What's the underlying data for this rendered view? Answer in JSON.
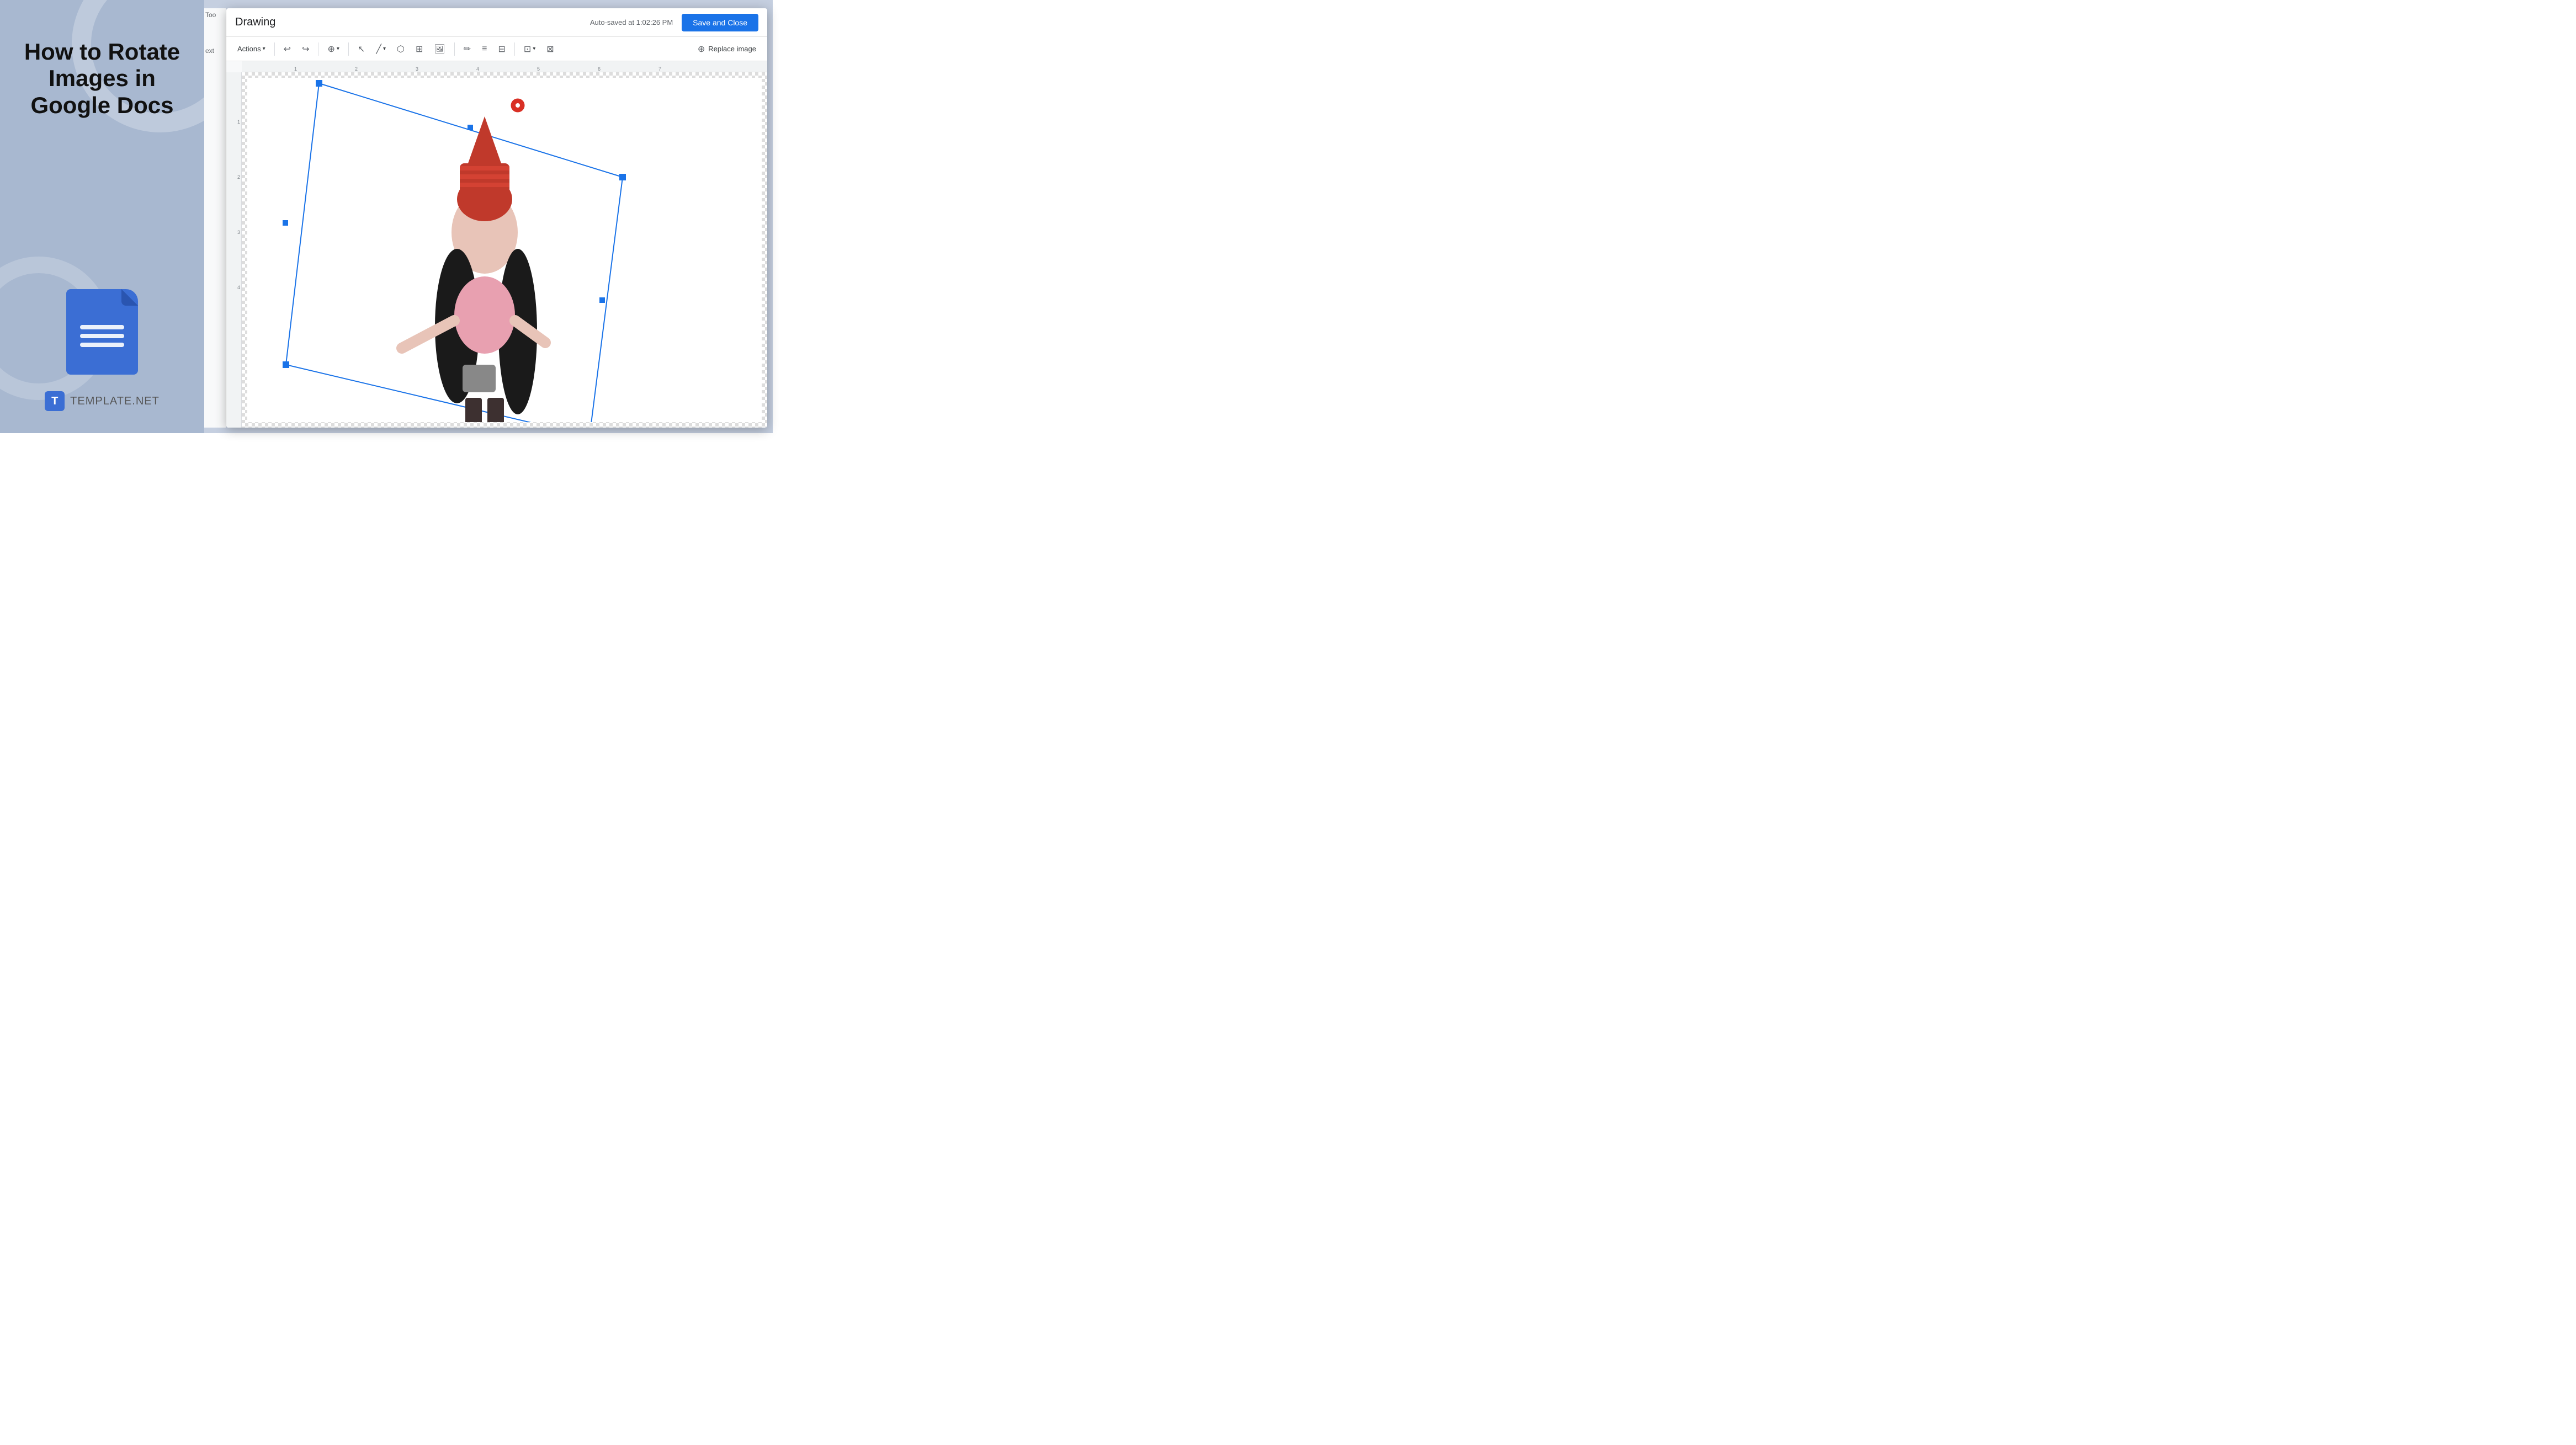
{
  "left": {
    "title": "How to Rotate Images in Google Docs",
    "brand_letter": "T",
    "brand_name": "TEMPLATE",
    "brand_suffix": ".NET"
  },
  "dialog": {
    "title": "Drawing",
    "autosaved": "Auto-saved at 1:02:26 PM",
    "save_close_label": "Save and Close",
    "toolbar": {
      "actions_label": "Actions",
      "replace_image_label": "Replace image"
    }
  },
  "sidebar_partial": {
    "text1": "Too",
    "text2": "ext"
  },
  "icons": {
    "undo": "↩",
    "redo": "↪",
    "zoom": "🔍",
    "cursor": "↖",
    "line": "╱",
    "shape": "⬡",
    "textbox": "⊞",
    "image": "🖼",
    "pen": "✏",
    "format": "≡",
    "table": "⊞",
    "crop": "⊡",
    "transform": "⊟",
    "replace": "⊞"
  },
  "colors": {
    "accent_blue": "#1a73e8",
    "left_bg": "#a8b8d0",
    "right_bg": "#c5cfe0",
    "rotate_handle": "#d93025"
  },
  "ruler": {
    "h_marks": [
      "1",
      "2",
      "3",
      "4",
      "5",
      "6",
      "7"
    ],
    "v_marks": [
      "1",
      "2",
      "3",
      "4"
    ]
  }
}
